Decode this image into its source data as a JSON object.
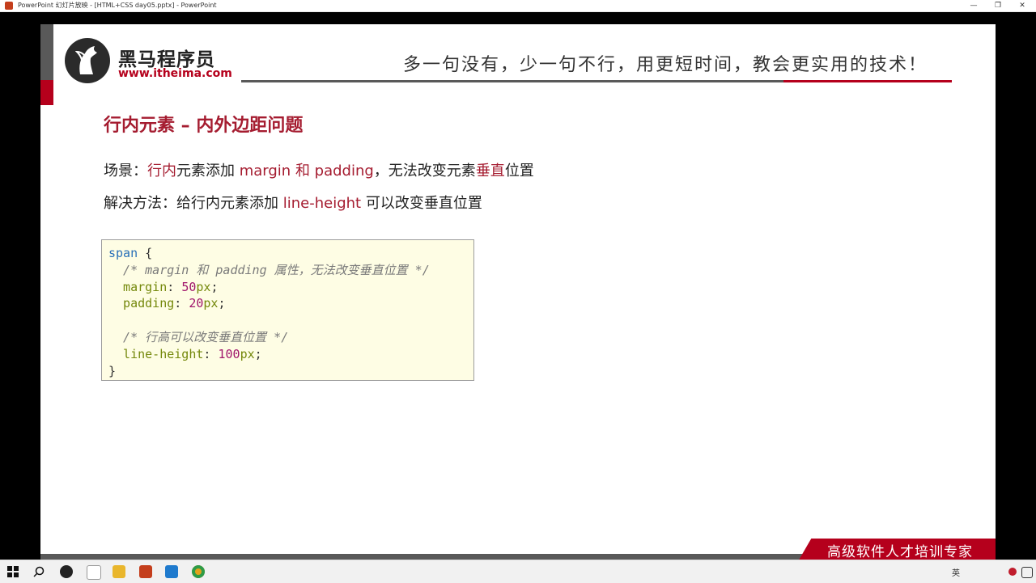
{
  "window": {
    "title": "PowerPoint 幻灯片放映 - [HTML+CSS day05.pptx] - PowerPoint",
    "minimize_glyph": "—",
    "restore_glyph": "❐",
    "close_glyph": "✕"
  },
  "slide": {
    "logo": {
      "name": "黑马程序员",
      "url": "www.itheima.com"
    },
    "slogan": "多一句没有，少一句不行，用更短时间，教会更实用的技术！",
    "heading": "行内元素 – 内外边距问题",
    "line1": {
      "p1": "场景：",
      "p2": "行内",
      "p3": "元素添加 ",
      "p4": "margin 和 padding",
      "p5": "，无法改变元素",
      "p6": "垂直",
      "p7": "位置"
    },
    "line2": {
      "p1": "解决方法：给行内元素添加 ",
      "p2": "line-height",
      "p3": " 可以改变垂直位置"
    },
    "code": {
      "selector": "span",
      "open": " {",
      "comment1": "  /* margin 和 padding 属性，无法改变垂直位置 */",
      "prop1": "  margin",
      "num1": "50",
      "unit1": "px",
      "prop2": "  padding",
      "num2": "20",
      "unit2": "px",
      "comment2": "  /* 行高可以改变垂直位置 */",
      "prop3": "  line-height",
      "num3": "100",
      "unit3": "px",
      "colon": ": ",
      "semi": ";",
      "close": "}"
    },
    "banner": "高级软件人才培训专家"
  },
  "taskbar": {
    "tray_text": "英"
  },
  "colors": {
    "accent_red": "#a51c30",
    "brand_red": "#b5001c",
    "code_bg": "#fefde4"
  }
}
